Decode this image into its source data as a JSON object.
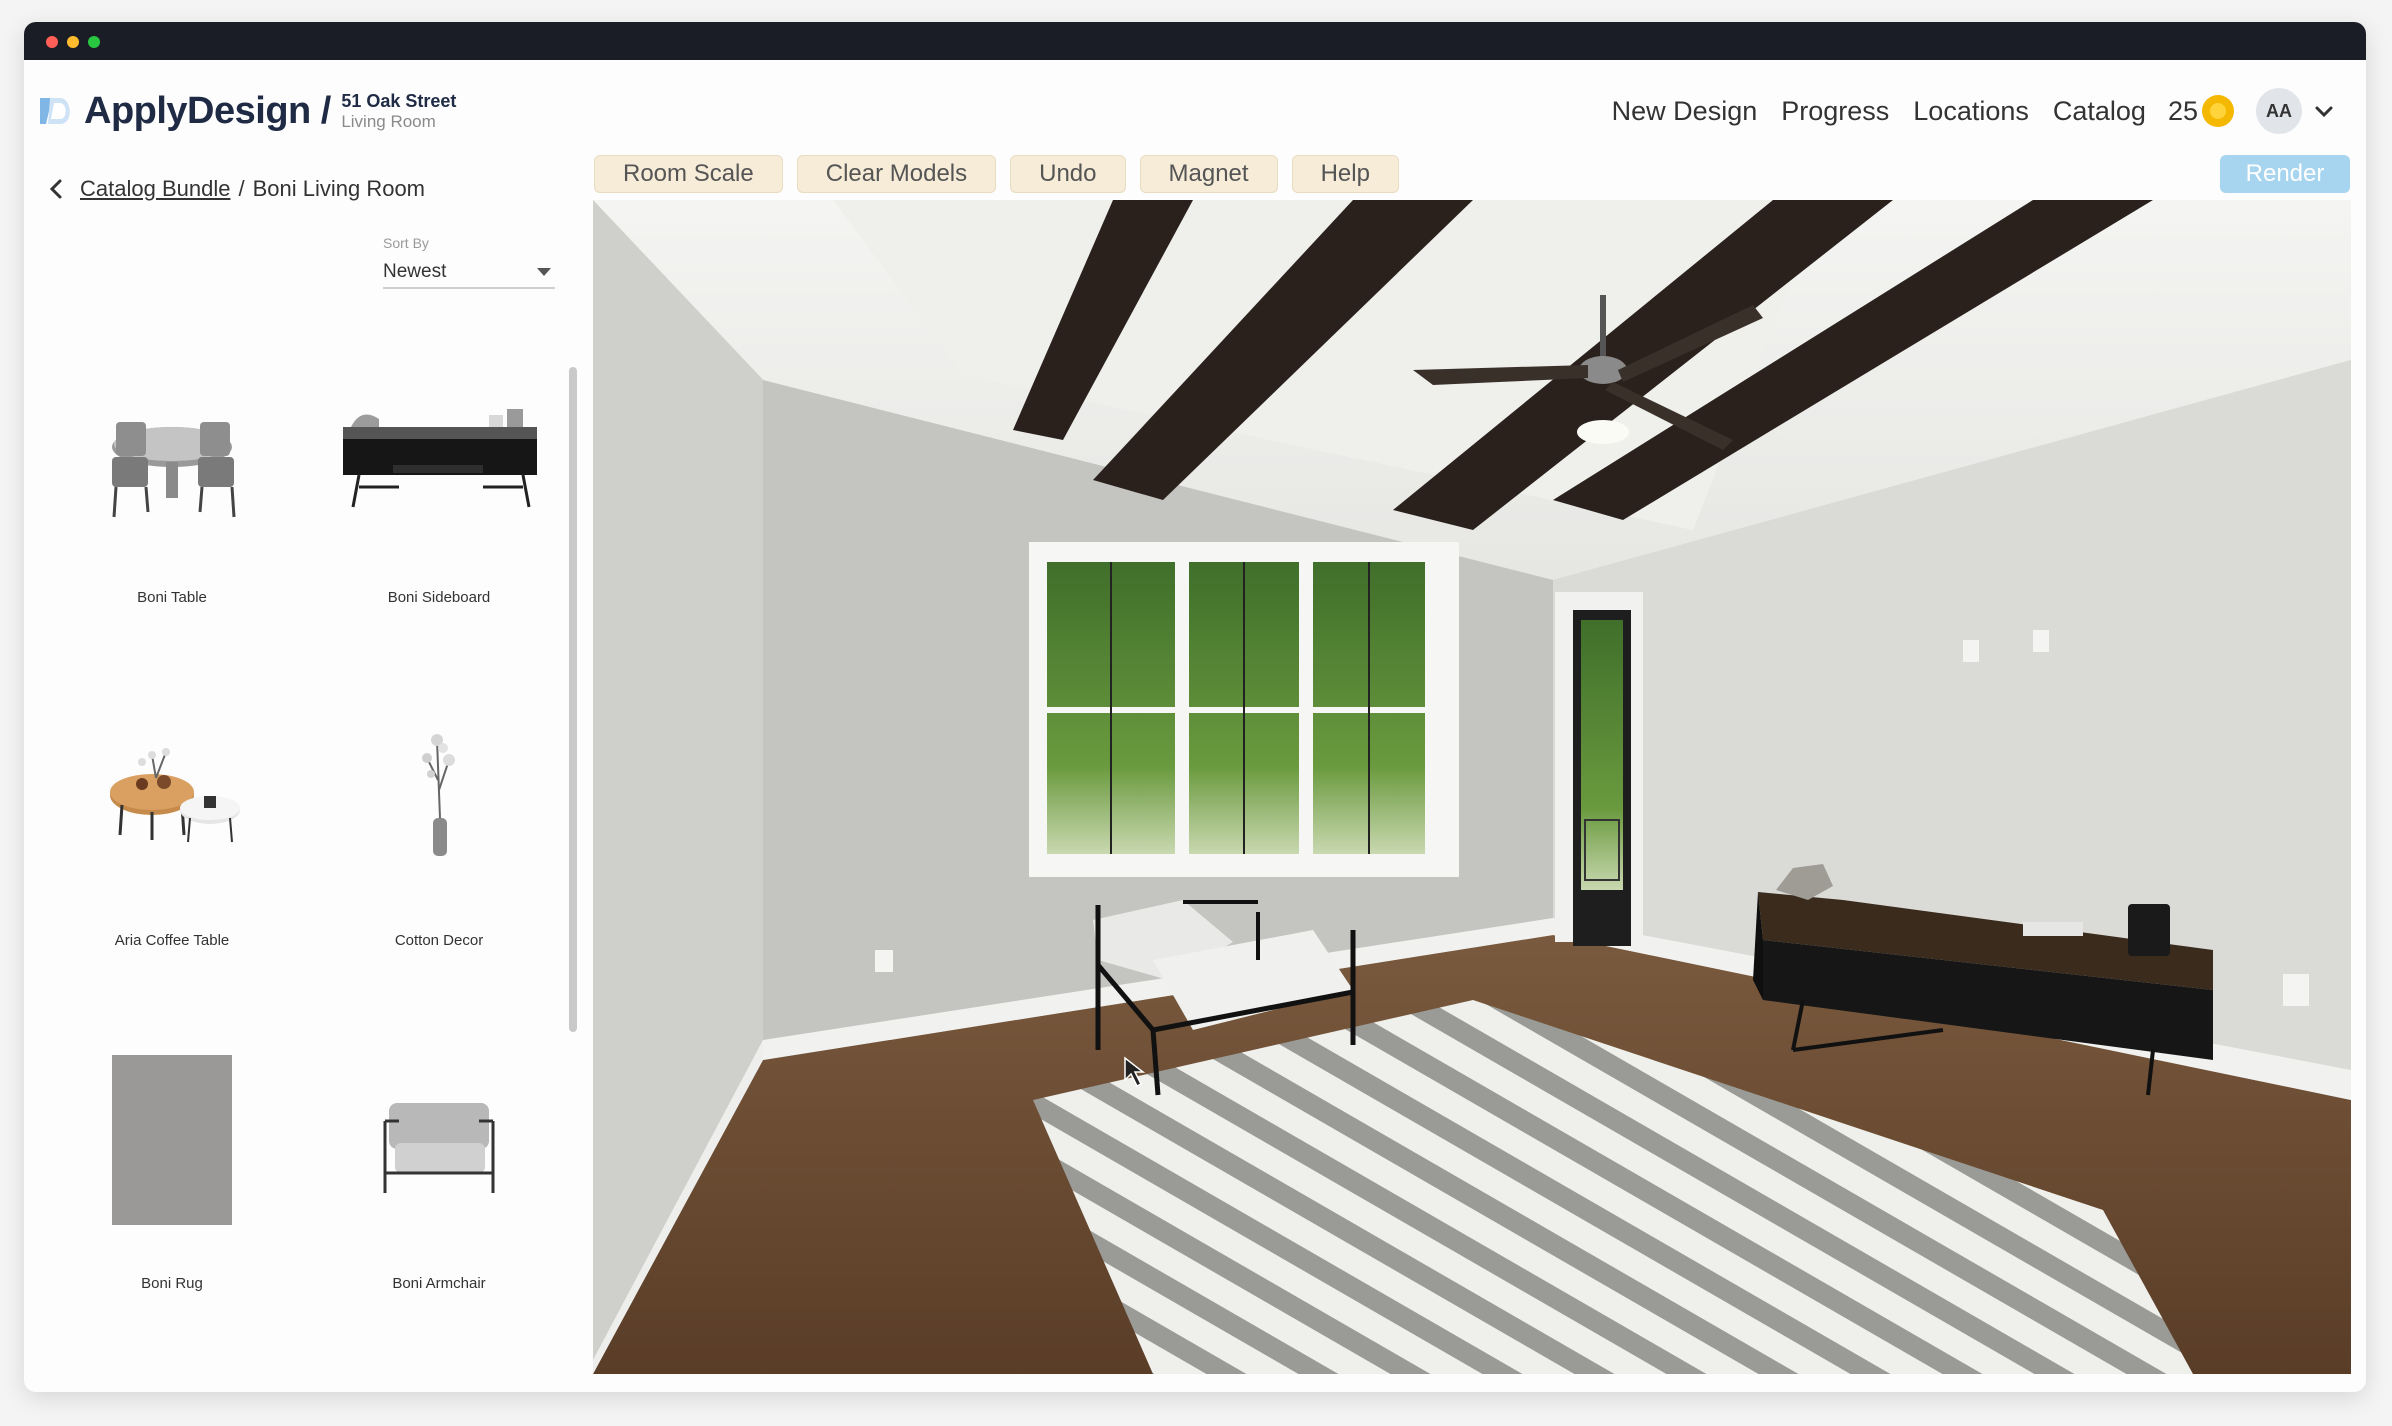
{
  "header": {
    "logo_text": "ApplyDesign",
    "separator": "/",
    "project_name": "51 Oak Street",
    "project_room": "Living Room"
  },
  "nav": {
    "new_design": "New Design",
    "progress": "Progress",
    "locations": "Locations",
    "catalog": "Catalog",
    "credits": "25",
    "avatar_initials": "AA"
  },
  "breadcrumb": {
    "parent": "Catalog Bundle",
    "separator": "/",
    "current": "Boni Living Room"
  },
  "sort": {
    "label": "Sort By",
    "value": "Newest"
  },
  "products": [
    {
      "name": "Boni Table",
      "icon": "dining-table-icon"
    },
    {
      "name": "Boni Sideboard",
      "icon": "sideboard-icon"
    },
    {
      "name": "Aria Coffee Table",
      "icon": "coffee-table-icon"
    },
    {
      "name": "Cotton Decor",
      "icon": "vase-icon"
    },
    {
      "name": "Boni Rug",
      "icon": "rug-icon"
    },
    {
      "name": "Boni Armchair",
      "icon": "armchair-icon"
    }
  ],
  "toolbar": {
    "room_scale": "Room Scale",
    "clear_models": "Clear Models",
    "undo": "Undo",
    "magnet": "Magnet",
    "help": "Help",
    "render": "Render"
  },
  "colors": {
    "titlebar": "#1a1d26",
    "toolbar_button": "#f6ecd8",
    "render_button": "#a7d4ef",
    "coin": "#f5b800"
  }
}
